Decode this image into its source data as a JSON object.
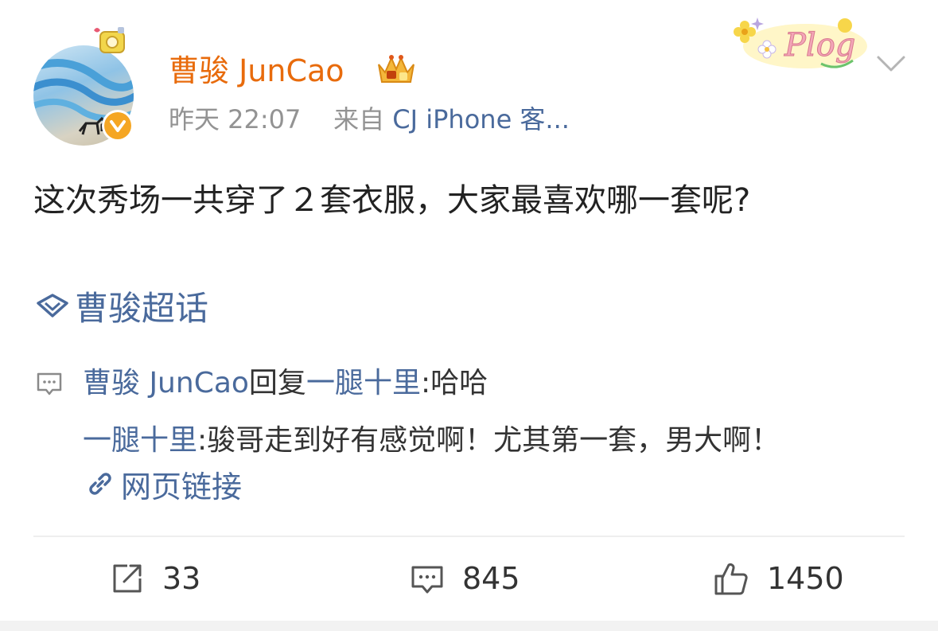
{
  "post": {
    "author": "曹骏 JunCao",
    "time": "昨天 22:07",
    "source_prefix": "来自",
    "source": "CJ iPhone 客...",
    "text": "这次秀场一共穿了２套衣服，大家最喜欢哪一套呢?",
    "topic": "曹骏超话",
    "sticker_text": "Plog"
  },
  "reply": {
    "author": "曹骏 JunCao",
    "verb": "回复",
    "target": "一腿十里",
    "target_colon": ":",
    "content": " 哈哈",
    "quoted_author": "一腿十里",
    "quoted_colon": ":",
    "quoted_content": " 骏哥走到好有感觉啊！尤其第一套，男大啊！",
    "link_label": "网页链接"
  },
  "actions": {
    "reposts": "33",
    "comments": "845",
    "likes": "1450"
  },
  "colors": {
    "username": "#e86b0c",
    "link": "#4a6a9c",
    "meta": "#939393",
    "verify": "#f5a623"
  },
  "icons": {
    "verify": "verified-badge-icon",
    "crown": "crown-icon",
    "chevron": "chevron-down-icon",
    "topic": "diamond-topic-icon",
    "reply": "comment-icon",
    "link": "link-icon",
    "share": "share-icon",
    "comment": "comment-icon",
    "like": "thumbs-up-icon"
  }
}
